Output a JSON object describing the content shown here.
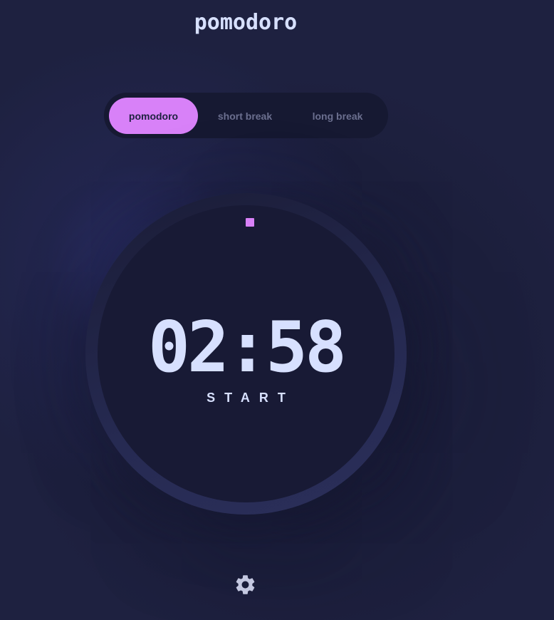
{
  "app": {
    "title": "pomodoro"
  },
  "mode_tabs": [
    {
      "label": "pomodoro",
      "active": true
    },
    {
      "label": "short break",
      "active": false
    },
    {
      "label": "long break",
      "active": false
    }
  ],
  "timer": {
    "time": "02:58",
    "action_label": "START"
  },
  "settings": {
    "icon": "gear-icon"
  },
  "colors": {
    "background": "#1e2140",
    "accent": "#d881f8",
    "text": "#d7e0ff",
    "tab_inactive_text": "#6b6f8f",
    "panel": "#161932"
  }
}
